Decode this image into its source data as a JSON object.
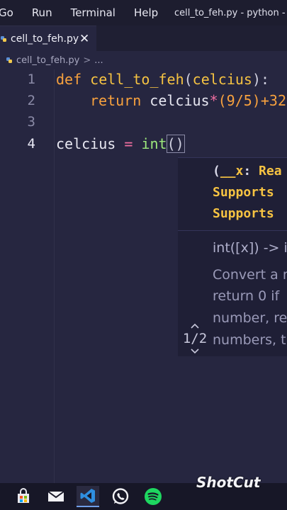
{
  "menubar": {
    "items": [
      "Go",
      "Run",
      "Terminal",
      "Help"
    ],
    "window_title": "cell_to_feh.py - python - Vi"
  },
  "tab": {
    "filename": "cell_to_feh.py",
    "close_glyph": "✕"
  },
  "breadcrumb": {
    "file": "cell_to_feh.py",
    "separator": ">",
    "more": "..."
  },
  "editor": {
    "line_numbers": [
      "1",
      "2",
      "3",
      "4"
    ],
    "line1": {
      "def": "def",
      "space": " ",
      "name": "cell_to_feh",
      "open": "(",
      "param": "celcius",
      "close": "):"
    },
    "line2": {
      "return": "return",
      "var": "celcius",
      "op": "*",
      "expr": "(9/5)",
      "plus": "+32"
    },
    "line4": {
      "var": "celcius",
      "eq": "=",
      "builtin": "int",
      "parens": "()"
    }
  },
  "hover": {
    "sig_open": "(",
    "sig_param": "__x",
    "sig_colon": ":",
    "sig_type": "Rea",
    "sig_line2": "Supports",
    "sig_line3": "Supports",
    "doc_signature": "int([x]) -> i",
    "doc_lines": [
      "Convert a n",
      "return 0 if",
      "number, re",
      "numbers, t"
    ],
    "pager": "1/2"
  },
  "taskbar": {
    "icons": [
      "store-icon",
      "mail-icon",
      "vscode-icon",
      "whatsapp-icon",
      "spotify-icon"
    ]
  },
  "watermark": "ShotCut",
  "colors": {
    "editor_bg": "#262640",
    "keyword": "#f7a13e",
    "function": "#f6c342",
    "operator": "#f06ea0",
    "builtin": "#9de87c"
  }
}
